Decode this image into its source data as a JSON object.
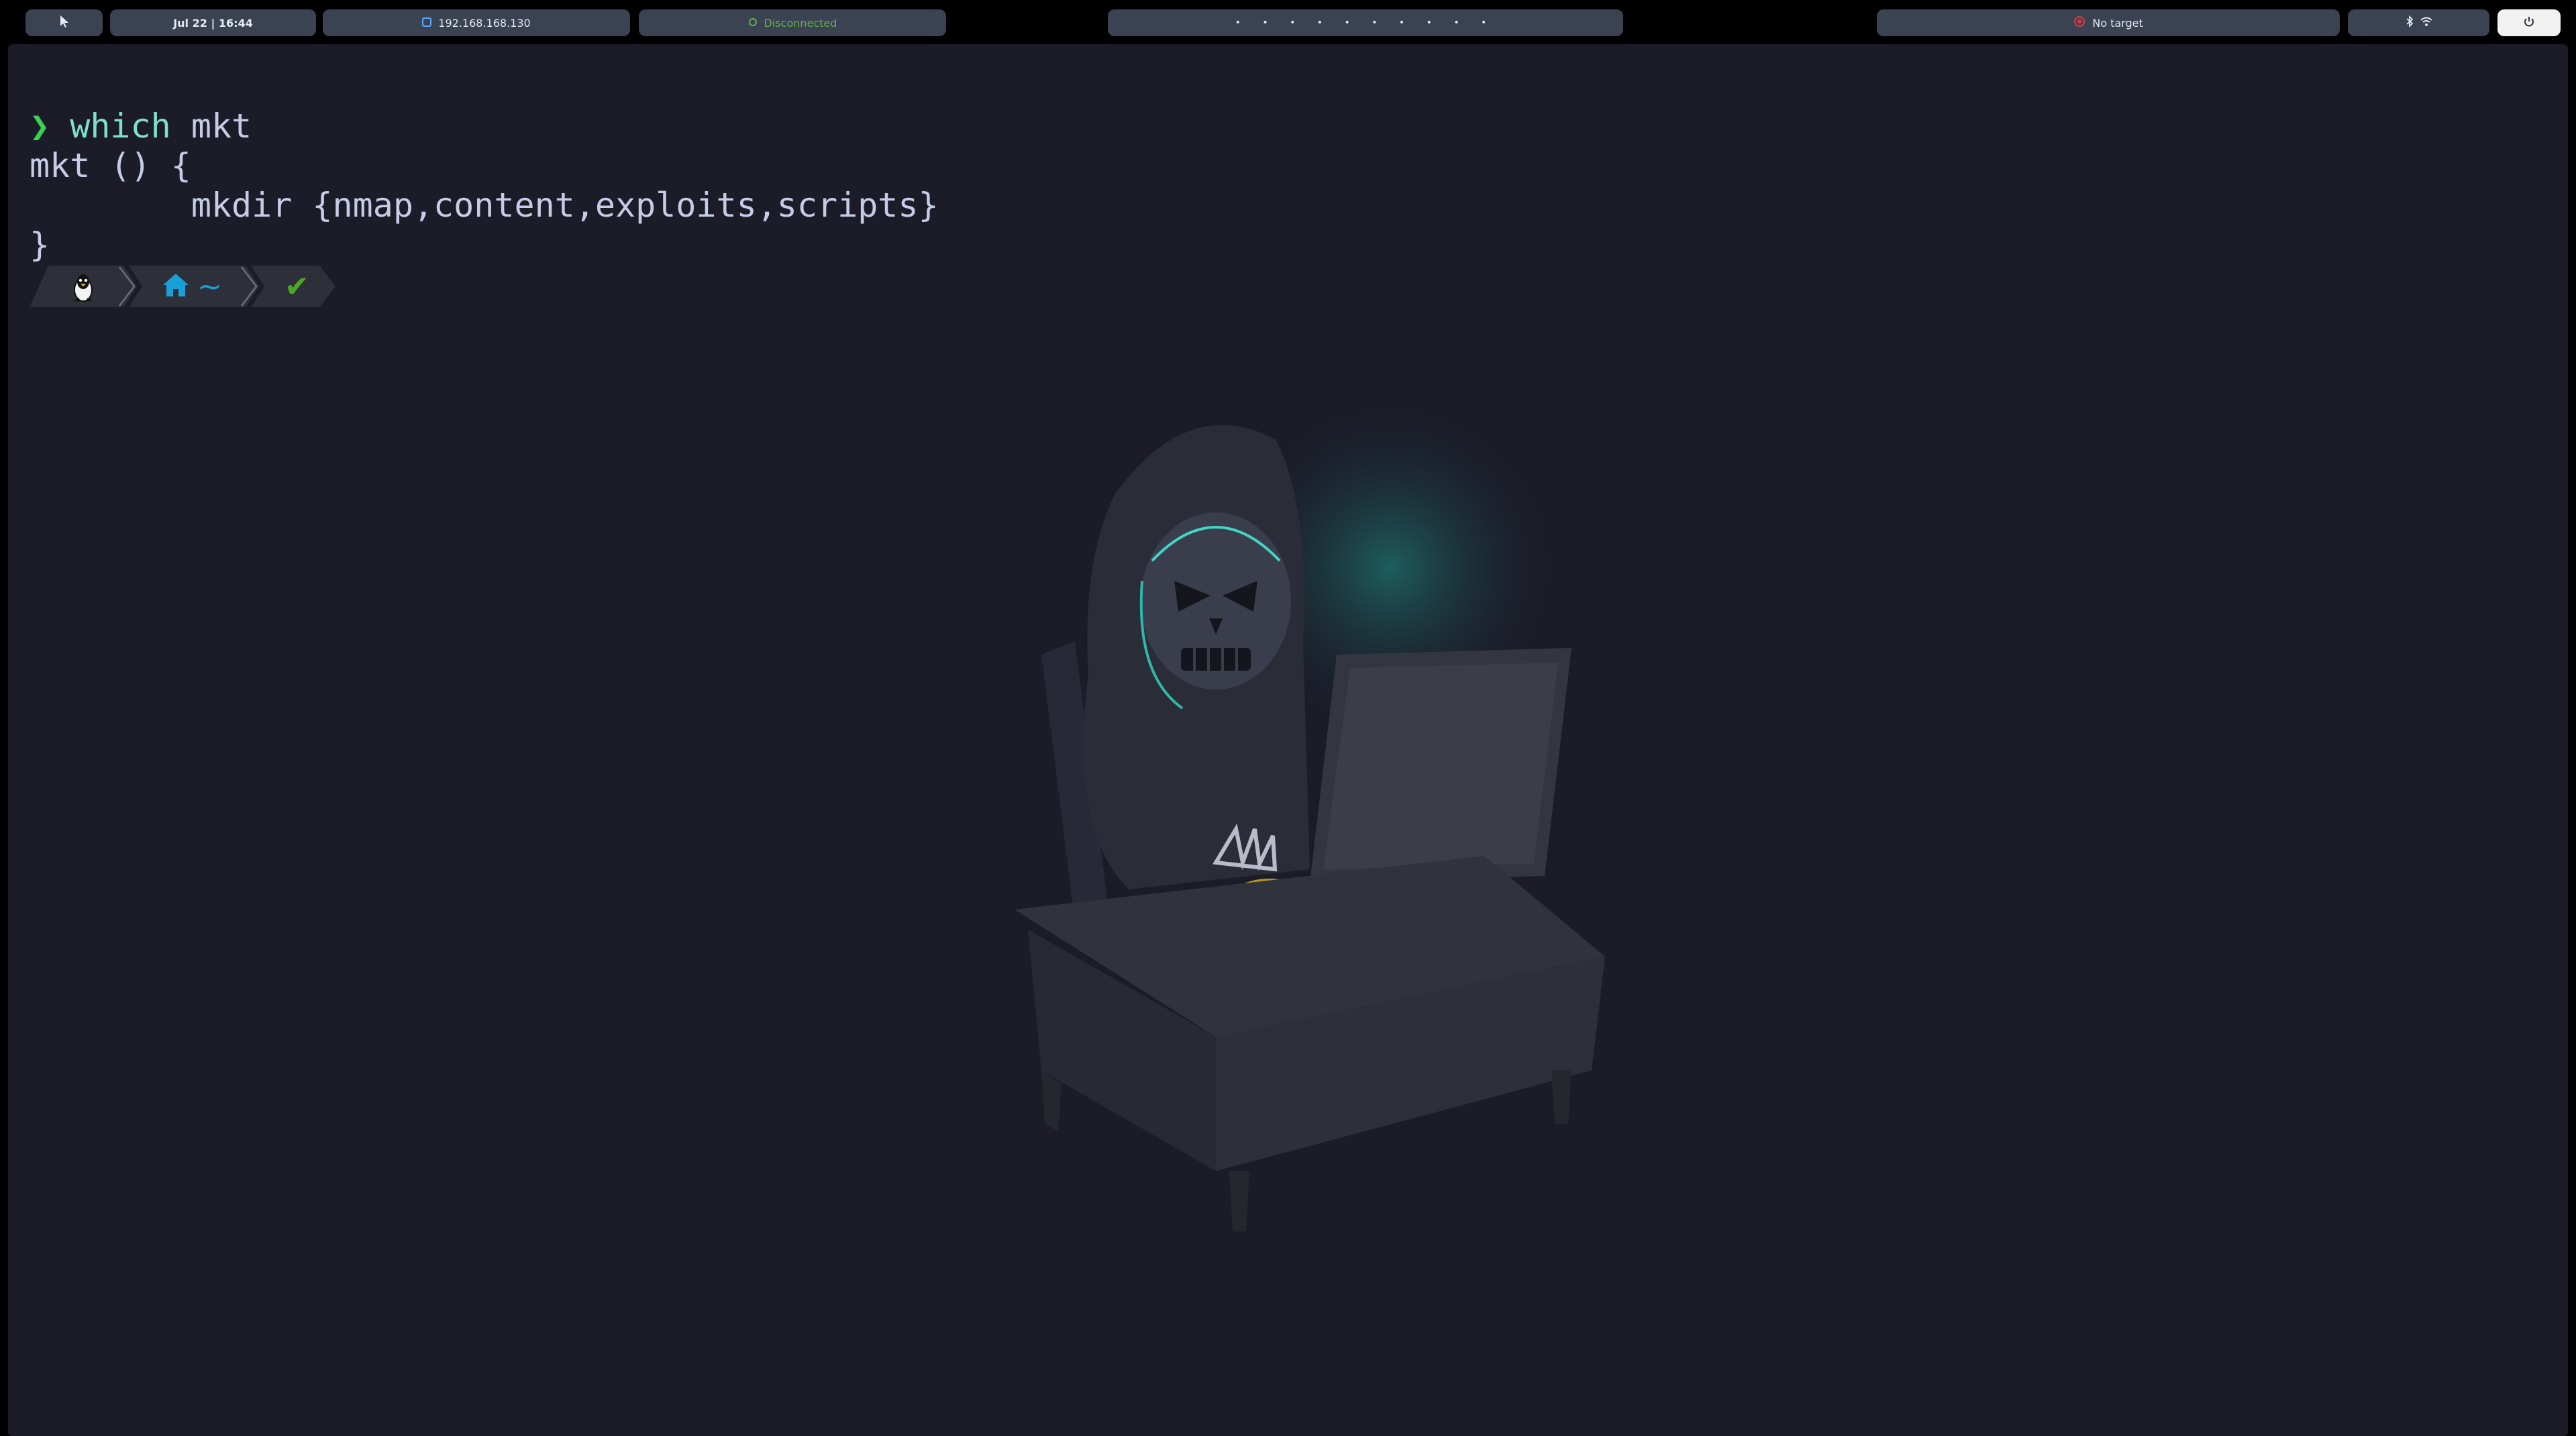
{
  "topbar": {
    "menu_icon": "cursor-icon",
    "datetime": "Jul 22 | 16:44",
    "ip_icon": "network-icon",
    "ip_address": "192.168.168.130",
    "vpn_icon": "status-dot-icon",
    "vpn_status": "Disconnected",
    "workspaces": "• • • • • • • • • •",
    "target_icon": "target-icon",
    "target": "No target",
    "tray_icons": [
      "bluetooth-icon",
      "wifi-icon"
    ],
    "power_icon": "power-icon",
    "colors": {
      "bar_background": "#000000",
      "pill_background": "#3b4252",
      "vpn_green": "#5fb34a",
      "target_red": "#e0383e"
    }
  },
  "terminal": {
    "prompt_symbol": "❯",
    "command": "which",
    "command_arg": " mkt",
    "output": [
      "mkt () {",
      "        mkdir {nmap,content,exploits,scripts}",
      "}"
    ],
    "prompt_segments": {
      "os_icon": "linux-penguin-icon",
      "dir_icon": "home-icon",
      "dir": "~",
      "status_icon": "checkmark-icon",
      "status": "✔"
    },
    "wallpaper": "hooded-skeleton-hacker-at-computer",
    "colors": {
      "background": "#1b1c28",
      "text": "#c6cbe6",
      "prompt_green": "#39d353",
      "command_teal": "#7ee0c8",
      "dir_blue": "#1aa0d8",
      "check_green": "#4aa820"
    }
  }
}
